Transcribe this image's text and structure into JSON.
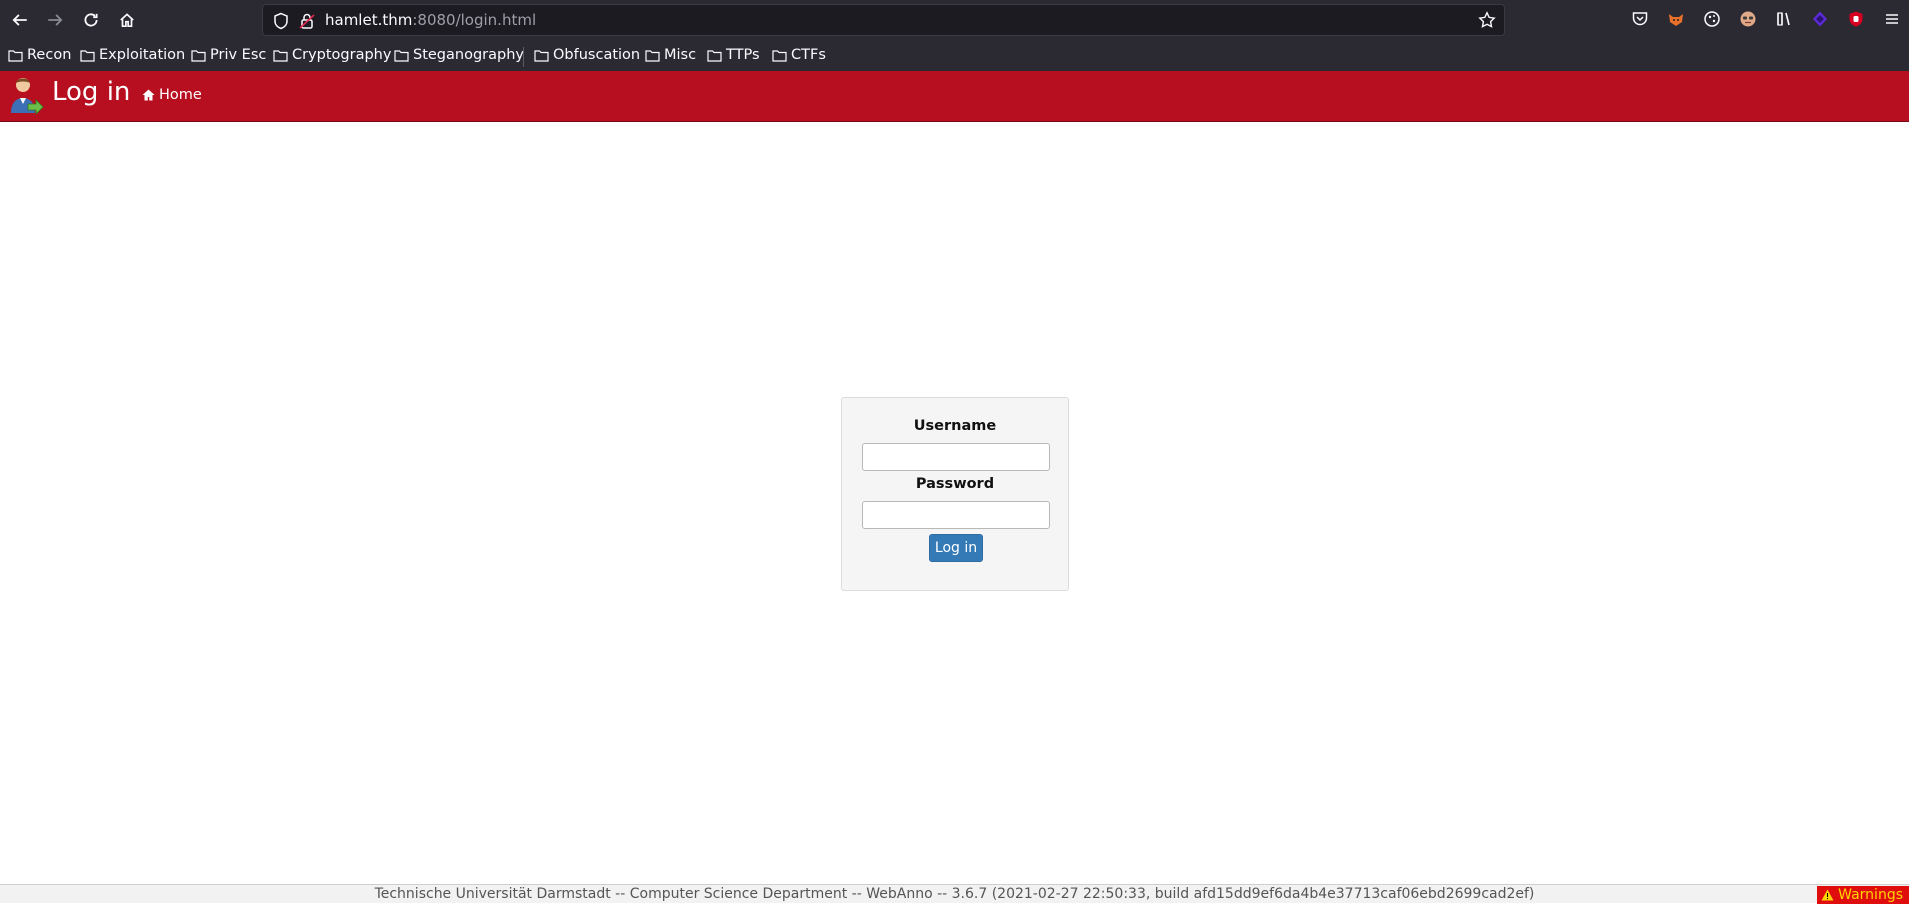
{
  "browser": {
    "url_host": "hamlet.thm",
    "url_rest": ":8080/login.html",
    "bookmarks": [
      "Recon",
      "Exploitation",
      "Priv Esc",
      "Cryptography",
      "Steganography",
      "Obfuscation",
      "Misc",
      "TTPs",
      "CTFs"
    ]
  },
  "header": {
    "title": "Log in",
    "home_label": "Home",
    "color": "#b70f20"
  },
  "login": {
    "username_label": "Username",
    "username_value": "",
    "password_label": "Password",
    "password_value": "",
    "submit_label": "Log in"
  },
  "footer": {
    "text": "Technische Universität Darmstadt -- Computer Science Department -- WebAnno -- 3.6.7 (2021-02-27 22:50:33, build afd15dd9ef6da4b4e37713caf06ebd2699cad2ef)",
    "warnings_label": "Warnings"
  }
}
